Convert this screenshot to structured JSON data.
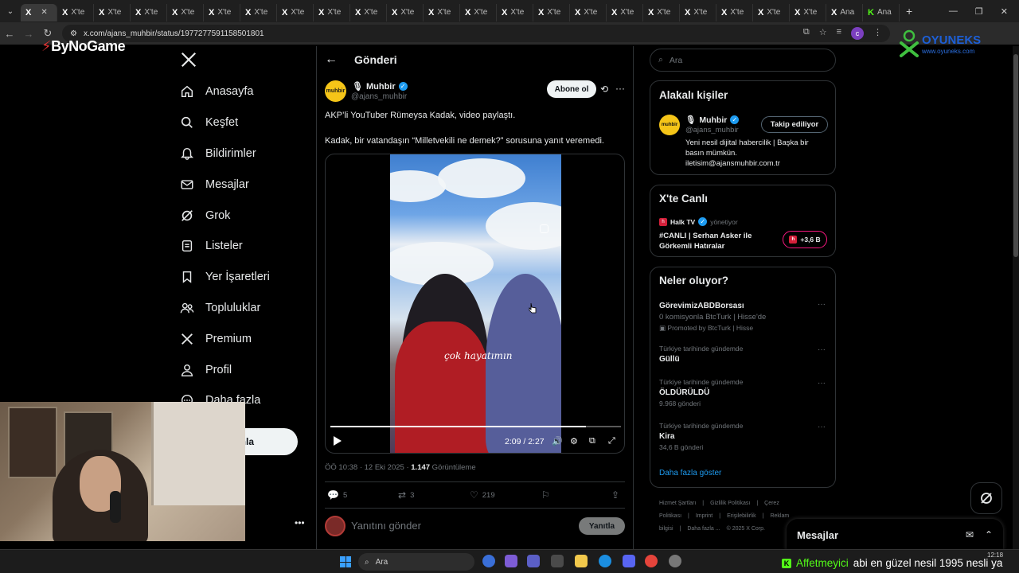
{
  "browser": {
    "tabs": [
      {
        "label": "",
        "logo": "X",
        "active": true
      },
      {
        "label": "X'te",
        "logo": "X"
      },
      {
        "label": "X'te",
        "logo": "X"
      },
      {
        "label": "X'te",
        "logo": "X"
      },
      {
        "label": "X'te",
        "logo": "X"
      },
      {
        "label": "X'te",
        "logo": "X"
      },
      {
        "label": "X'te",
        "logo": "X"
      },
      {
        "label": "X'te",
        "logo": "X"
      },
      {
        "label": "X'te",
        "logo": "X"
      },
      {
        "label": "X'te",
        "logo": "X"
      },
      {
        "label": "X'te",
        "logo": "X"
      },
      {
        "label": "X'te",
        "logo": "X"
      },
      {
        "label": "X'te",
        "logo": "X"
      },
      {
        "label": "X'te",
        "logo": "X"
      },
      {
        "label": "X'te",
        "logo": "X"
      },
      {
        "label": "X'te",
        "logo": "X"
      },
      {
        "label": "X'te",
        "logo": "X"
      },
      {
        "label": "X'te",
        "logo": "X"
      },
      {
        "label": "X'te",
        "logo": "X"
      },
      {
        "label": "X'te",
        "logo": "X"
      },
      {
        "label": "X'te",
        "logo": "X"
      },
      {
        "label": "X'te",
        "logo": "X"
      },
      {
        "label": "Ana",
        "logo": "X"
      },
      {
        "label": "Ana",
        "logo": "K"
      }
    ],
    "url": "x.com/ajans_muhbir/status/1977277591158501801"
  },
  "overlays": {
    "bynogame": "ByNoGame",
    "oyuneks_title": "OYUNEKS",
    "oyuneks_url": "www.oyuneks.com"
  },
  "nav": {
    "items": [
      {
        "label": "Anasayfa",
        "icon": "home-icon"
      },
      {
        "label": "Keşfet",
        "icon": "search-icon"
      },
      {
        "label": "Bildirimler",
        "icon": "bell-icon"
      },
      {
        "label": "Mesajlar",
        "icon": "mail-icon"
      },
      {
        "label": "Grok",
        "icon": "grok-icon"
      },
      {
        "label": "Listeler",
        "icon": "list-icon"
      },
      {
        "label": "Yer İşaretleri",
        "icon": "bookmark-icon"
      },
      {
        "label": "Topluluklar",
        "icon": "people-icon"
      },
      {
        "label": "Premium",
        "icon": "x-icon"
      },
      {
        "label": "Profil",
        "icon": "person-icon"
      },
      {
        "label": "Daha fazla",
        "icon": "more-circle-icon"
      }
    ],
    "post_button": "ayınla"
  },
  "post": {
    "page_title": "Gönderi",
    "author_name": "Muhbir",
    "author_handle": "@ajans_muhbir",
    "avatar_text": "muhbir",
    "subscribe": "Abone ol",
    "text_line1": "AKP’li YouTuber Rümeysa Kadak, video paylaştı.",
    "text_line2": "Kadak, bir vatandaşın “Milletvekili ne demek?” sorusuna yanıt veremedi.",
    "video": {
      "caption": "çok hayatımın",
      "time": "2:09 / 2:27",
      "progress": 0.879
    },
    "timestamp": "ÖÖ 10:38 · 12 Eki 2025 · ",
    "views_count": "1.147",
    "views_label": " Görüntüleme",
    "replies": "5",
    "reposts": "3",
    "likes": "219",
    "reply_placeholder": "Yanıtını gönder",
    "reply_button": "Yanıtla"
  },
  "right": {
    "search_placeholder": "Ara",
    "related_title": "Alakalı kişiler",
    "related_name": "Muhbir",
    "related_handle": "@ajans_muhbir",
    "related_follow": "Takip ediliyor",
    "related_bio": "Yeni nesil dijital habercilik | Başka bir basın mümkün. iletisim@ajansmuhbir.com.tr",
    "live_title": "X'te Canlı",
    "live_host": "Halk TV",
    "live_host_suffix": "yönetiyor",
    "live_stream": "#CANLI | Serhan Asker ile Görkemli Hatıralar",
    "live_count": "+3,6 B",
    "trends_title": "Neler oluyor?",
    "trends": [
      {
        "meta": "",
        "name": "GörevimizABDBorsası",
        "sub": "0 komisyonla BtcTurk | Hisse'de",
        "sub2": "Promoted by BtcTurk | Hisse"
      },
      {
        "meta": "Türkiye tarihinde gündemde",
        "name": "Güllü",
        "sub": "",
        "sub2": ""
      },
      {
        "meta": "Türkiye tarihinde gündemde",
        "name": "ÖLDÜRÜLDÜ",
        "sub": "9.968 gönderi",
        "sub2": ""
      },
      {
        "meta": "Türkiye tarihinde gündemde",
        "name": "Kira",
        "sub": "34,6 B gönderi",
        "sub2": ""
      }
    ],
    "show_more": "Daha fazla göster",
    "footer": [
      "Hizmet Şartları",
      "|",
      "Gizlilik Politikası",
      "|",
      "Çerez Politikası",
      "|",
      "Imprint",
      "|",
      "Erişilebilirlik",
      "|",
      "Reklam bilgisi",
      "|",
      "Daha fazla ...",
      "© 2025 X Corp."
    ],
    "messages": "Mesajlar"
  },
  "taskbar": {
    "search": "Ara",
    "time": "12:18",
    "ticker_user": "Affetmeyici",
    "ticker_text": "abi en güzel nesil 1995 nesli ya"
  },
  "colors": {
    "accent": "#1d9bf0",
    "kick": "#53fc18",
    "live": "#f91880"
  }
}
